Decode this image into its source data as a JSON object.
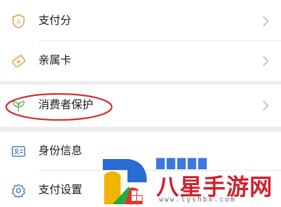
{
  "menu": {
    "items": [
      {
        "label": "支付分",
        "icon": "score-badge-icon"
      },
      {
        "label": "亲属卡",
        "icon": "family-card-icon"
      },
      {
        "label": "消费者保护",
        "icon": "leaf-shield-icon"
      },
      {
        "label": "身份信息",
        "icon": "id-card-icon"
      },
      {
        "label": "支付设置",
        "icon": "gear-icon"
      }
    ]
  },
  "annotation": {
    "color": "#d6282b"
  },
  "watermark": {
    "title": "八星手游网",
    "url": "www.lyshbx.com",
    "brand_color": "#d11f2c",
    "ghost_text": "▇▇▇▇▇"
  },
  "colors": {
    "accent_orange": "#e8a04a",
    "leaf_green": "#6bbf59",
    "icon_blue": "#4a78c2",
    "chevron": "#b3b3b3"
  }
}
